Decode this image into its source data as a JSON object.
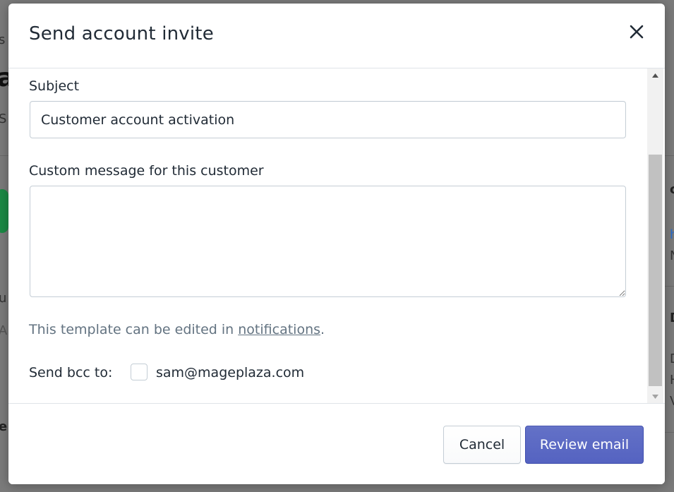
{
  "colors": {
    "primary": "#5c6ac4",
    "overlay": "#7b7b7b",
    "text": "#212b36",
    "subdued": "#637381",
    "border": "#c4cdd5"
  },
  "modal": {
    "title": "Send account invite",
    "close_icon": "close-icon"
  },
  "form": {
    "subject_label": "Subject",
    "subject_value": "Customer account activation",
    "message_label": "Custom message for this customer",
    "message_value": "",
    "help_prefix": "This template can be edited in ",
    "help_link": "notifications",
    "help_suffix": ".",
    "bcc_label": "Send bcc to:",
    "bcc_email": "sam@mageplaza.com",
    "bcc_checked": false
  },
  "footer": {
    "cancel_label": "Cancel",
    "review_label": "Review email"
  }
}
